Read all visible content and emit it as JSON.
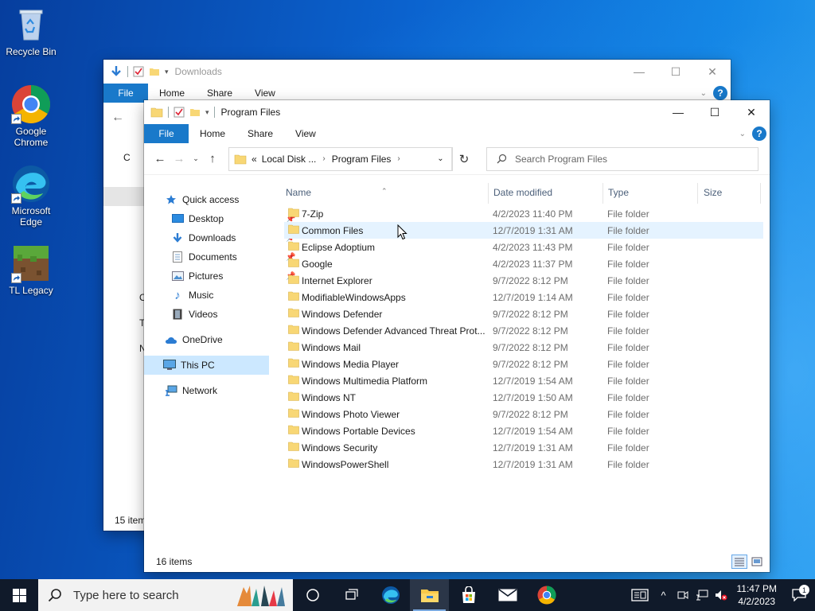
{
  "desktop": {
    "icons": [
      {
        "label": "Recycle Bin",
        "icon": "recycle-bin-icon"
      },
      {
        "label": "Google Chrome",
        "icon": "chrome-icon"
      },
      {
        "label": "Microsoft Edge",
        "icon": "edge-icon"
      },
      {
        "label": "TL Legacy",
        "icon": "tl-legacy-icon"
      }
    ]
  },
  "back_window": {
    "title": "Downloads",
    "tabs": {
      "file": "File",
      "home": "Home",
      "share": "Share",
      "view": "View"
    },
    "status": "15 item",
    "partial_nav": [
      "C",
      "O",
      "T",
      "N"
    ]
  },
  "front_window": {
    "title": "Program Files",
    "controls": {
      "minimize": "—",
      "maximize": "☐",
      "close": "✕"
    },
    "ribbon": {
      "file": "File",
      "home": "Home",
      "share": "Share",
      "view": "View"
    },
    "breadcrumb": {
      "overflow": "«",
      "crumbs": [
        "Local Disk ...",
        "Program Files"
      ]
    },
    "search": {
      "placeholder": "Search Program Files"
    },
    "nav": {
      "quick_access": "Quick access",
      "items": [
        {
          "label": "Desktop",
          "pinned": true
        },
        {
          "label": "Downloads",
          "pinned": true
        },
        {
          "label": "Documents",
          "pinned": true
        },
        {
          "label": "Pictures",
          "pinned": true
        },
        {
          "label": "Music",
          "pinned": false
        },
        {
          "label": "Videos",
          "pinned": false
        }
      ],
      "onedrive": "OneDrive",
      "this_pc": "This PC",
      "network": "Network"
    },
    "columns": {
      "name": "Name",
      "date": "Date modified",
      "type": "Type",
      "size": "Size"
    },
    "files": [
      {
        "name": "7-Zip",
        "date": "4/2/2023 11:40 PM",
        "type": "File folder"
      },
      {
        "name": "Common Files",
        "date": "12/7/2019 1:31 AM",
        "type": "File folder"
      },
      {
        "name": "Eclipse Adoptium",
        "date": "4/2/2023 11:43 PM",
        "type": "File folder"
      },
      {
        "name": "Google",
        "date": "4/2/2023 11:37 PM",
        "type": "File folder"
      },
      {
        "name": "Internet Explorer",
        "date": "9/7/2022 8:12 PM",
        "type": "File folder"
      },
      {
        "name": "ModifiableWindowsApps",
        "date": "12/7/2019 1:14 AM",
        "type": "File folder"
      },
      {
        "name": "Windows Defender",
        "date": "9/7/2022 8:12 PM",
        "type": "File folder"
      },
      {
        "name": "Windows Defender Advanced Threat Prot...",
        "date": "9/7/2022 8:12 PM",
        "type": "File folder"
      },
      {
        "name": "Windows Mail",
        "date": "9/7/2022 8:12 PM",
        "type": "File folder"
      },
      {
        "name": "Windows Media Player",
        "date": "9/7/2022 8:12 PM",
        "type": "File folder"
      },
      {
        "name": "Windows Multimedia Platform",
        "date": "12/7/2019 1:54 AM",
        "type": "File folder"
      },
      {
        "name": "Windows NT",
        "date": "12/7/2019 1:50 AM",
        "type": "File folder"
      },
      {
        "name": "Windows Photo Viewer",
        "date": "9/7/2022 8:12 PM",
        "type": "File folder"
      },
      {
        "name": "Windows Portable Devices",
        "date": "12/7/2019 1:54 AM",
        "type": "File folder"
      },
      {
        "name": "Windows Security",
        "date": "12/7/2019 1:31 AM",
        "type": "File folder"
      },
      {
        "name": "WindowsPowerShell",
        "date": "12/7/2019 1:31 AM",
        "type": "File folder"
      }
    ],
    "status": "16 items"
  },
  "taskbar": {
    "search_placeholder": "Type here to search",
    "apps": [
      "task-view",
      "edge",
      "file-explorer",
      "store",
      "mail",
      "chrome"
    ],
    "clock": {
      "time": "11:47 PM",
      "date": "4/2/2023"
    },
    "notification_count": "1"
  },
  "colors": {
    "accent": "#1979ca",
    "folder": "#f8d775",
    "selection": "#cce8ff",
    "hover_row": "#e5f3ff",
    "taskbar": "#101a2a"
  }
}
